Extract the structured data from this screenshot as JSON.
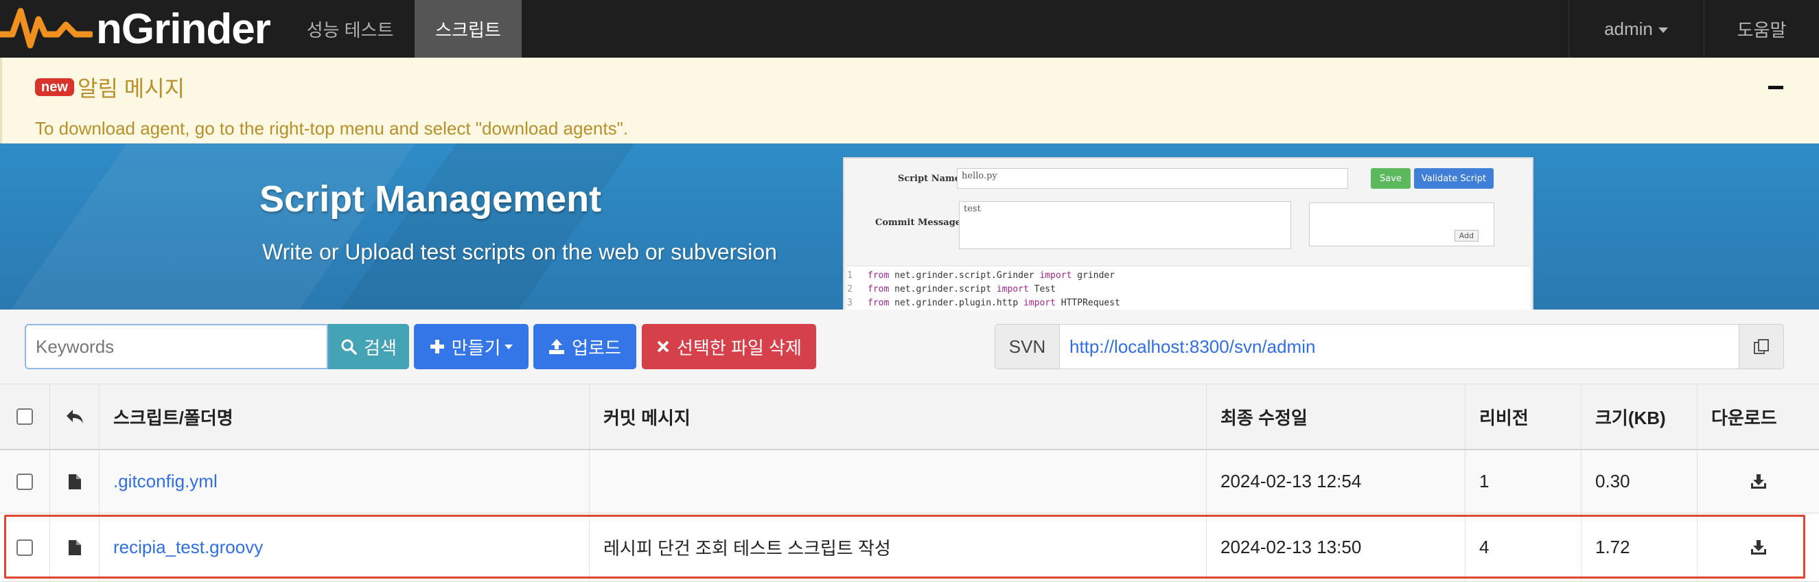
{
  "navbar": {
    "brand": "nGrinder",
    "menu": [
      {
        "label": "성능 테스트"
      },
      {
        "label": "스크립트"
      }
    ],
    "user": "admin",
    "help": "도움말",
    "colors": {
      "background": "#1e1e1e",
      "active": "#555555",
      "logo_orange": "#f0901e"
    }
  },
  "notice": {
    "badge": "new",
    "title": "알림 메시지",
    "message": "To download agent, go to the right-top menu and select \"download agents\".",
    "colors": {
      "background": "#fcf8e3",
      "text": "#b8902a"
    }
  },
  "banner": {
    "title": "Script Management",
    "subtitle": "Write or Upload test scripts on the web or subversion",
    "preview": {
      "script_name_label": "Script Name",
      "script_name_value": "hello.py",
      "save_label": "Save",
      "validate_label": "Validate Script",
      "commit_label": "Commit Message",
      "commit_value": "test",
      "add_label": "Add",
      "code_lines": [
        {
          "n": "1",
          "a": "from",
          "b": " net.grinder.script.Grinder ",
          "c": "import",
          "d": " grinder"
        },
        {
          "n": "2",
          "a": "from",
          "b": " net.grinder.script ",
          "c": "import",
          "d": " Test"
        },
        {
          "n": "3",
          "a": "from",
          "b": " net.grinder.plugin.http ",
          "c": "import",
          "d": " HTTPRequest"
        }
      ]
    }
  },
  "toolbar": {
    "search_placeholder": "Keywords",
    "search_label": "검색",
    "create_label": "만들기",
    "upload_label": "업로드",
    "delete_label": "선택한 파일 삭제",
    "svn_label": "SVN",
    "svn_url": "http://localhost:8300/svn/admin",
    "colors": {
      "search": "#44a3b4",
      "primary": "#3476e8",
      "danger": "#d6404a"
    }
  },
  "table": {
    "headers": {
      "name": "스크립트/폴더명",
      "message": "커밋 메시지",
      "modified": "최종 수정일",
      "revision": "리비전",
      "size": "크기(KB)",
      "download": "다운로드"
    },
    "rows": [
      {
        "name": ".gitconfig.yml",
        "message": "",
        "modified": "2024-02-13 12:54",
        "revision": "1",
        "size": "0.30",
        "icon": "file-icon"
      },
      {
        "name": "recipia_test.groovy",
        "message": "레시피 단건 조회 테스트 스크립트 작성",
        "modified": "2024-02-13 13:50",
        "revision": "4",
        "size": "1.72",
        "icon": "file-icon"
      }
    ],
    "highlight_color": "#e0452f"
  }
}
